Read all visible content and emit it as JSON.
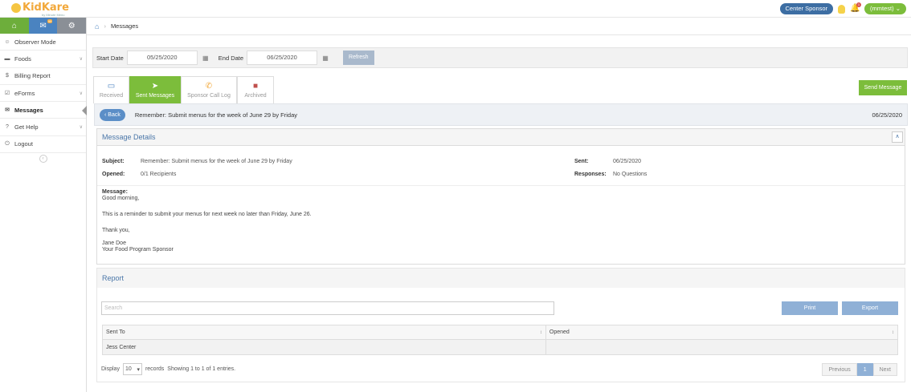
{
  "app": {
    "logo_text": "KidKare",
    "logo_sub": "by Minute Menu"
  },
  "topbar": {
    "role_label": "Center Sponsor",
    "notif_count": "1",
    "user_label": "(mmtest)"
  },
  "sidebar": {
    "mail_badge": "99",
    "items": [
      {
        "label": "Observer Mode",
        "icon": "users-icon"
      },
      {
        "label": "Foods",
        "icon": "foods-icon"
      },
      {
        "label": "Billing Report",
        "icon": "dollar-icon"
      },
      {
        "label": "eForms",
        "icon": "check-square-icon"
      },
      {
        "label": "Messages",
        "icon": "envelope-icon"
      },
      {
        "label": "Get Help",
        "icon": "help-icon"
      },
      {
        "label": "Logout",
        "icon": "power-icon"
      }
    ]
  },
  "breadcrumb": {
    "current": "Messages"
  },
  "filter": {
    "start_label": "Start Date",
    "start_value": "05/25/2020",
    "end_label": "End Date",
    "end_value": "06/25/2020",
    "refresh_label": "Refresh"
  },
  "tabs": [
    {
      "label": "Received"
    },
    {
      "label": "Sent Messages"
    },
    {
      "label": "Sponsor Call Log"
    },
    {
      "label": "Archived"
    }
  ],
  "send_message_label": "Send Message",
  "message_bar": {
    "back_label": "Back",
    "title": "Remember: Submit menus for the week of June 29 by Friday",
    "date": "06/25/2020"
  },
  "details": {
    "heading": "Message Details",
    "subject_label": "Subject:",
    "subject_value": "Remember: Submit menus for the week of June 29 by Friday",
    "opened_label": "Opened:",
    "opened_value": "0/1 Recipients",
    "sent_label": "Sent:",
    "sent_value": "06/25/2020",
    "responses_label": "Responses:",
    "responses_value": "No Questions",
    "message_label": "Message:",
    "line1": "Good morning,",
    "line2": "This is a reminder to submit your menus for next week no later than Friday, June 26.",
    "line3": "Thank you,",
    "line4": "Jane Doe",
    "line5": "Your Food Program Sponsor"
  },
  "report": {
    "heading": "Report",
    "search_placeholder": "Search",
    "print_label": "Print",
    "export_label": "Export",
    "columns": [
      "Sent To",
      "Opened"
    ],
    "rows": [
      [
        "Jess Center",
        ""
      ]
    ],
    "display_label": "Display",
    "page_size": "10",
    "records_label": "records",
    "showing_text": "Showing 1 to 1 of 1 entries.",
    "prev_label": "Previous",
    "current_page": "1",
    "next_label": "Next"
  }
}
